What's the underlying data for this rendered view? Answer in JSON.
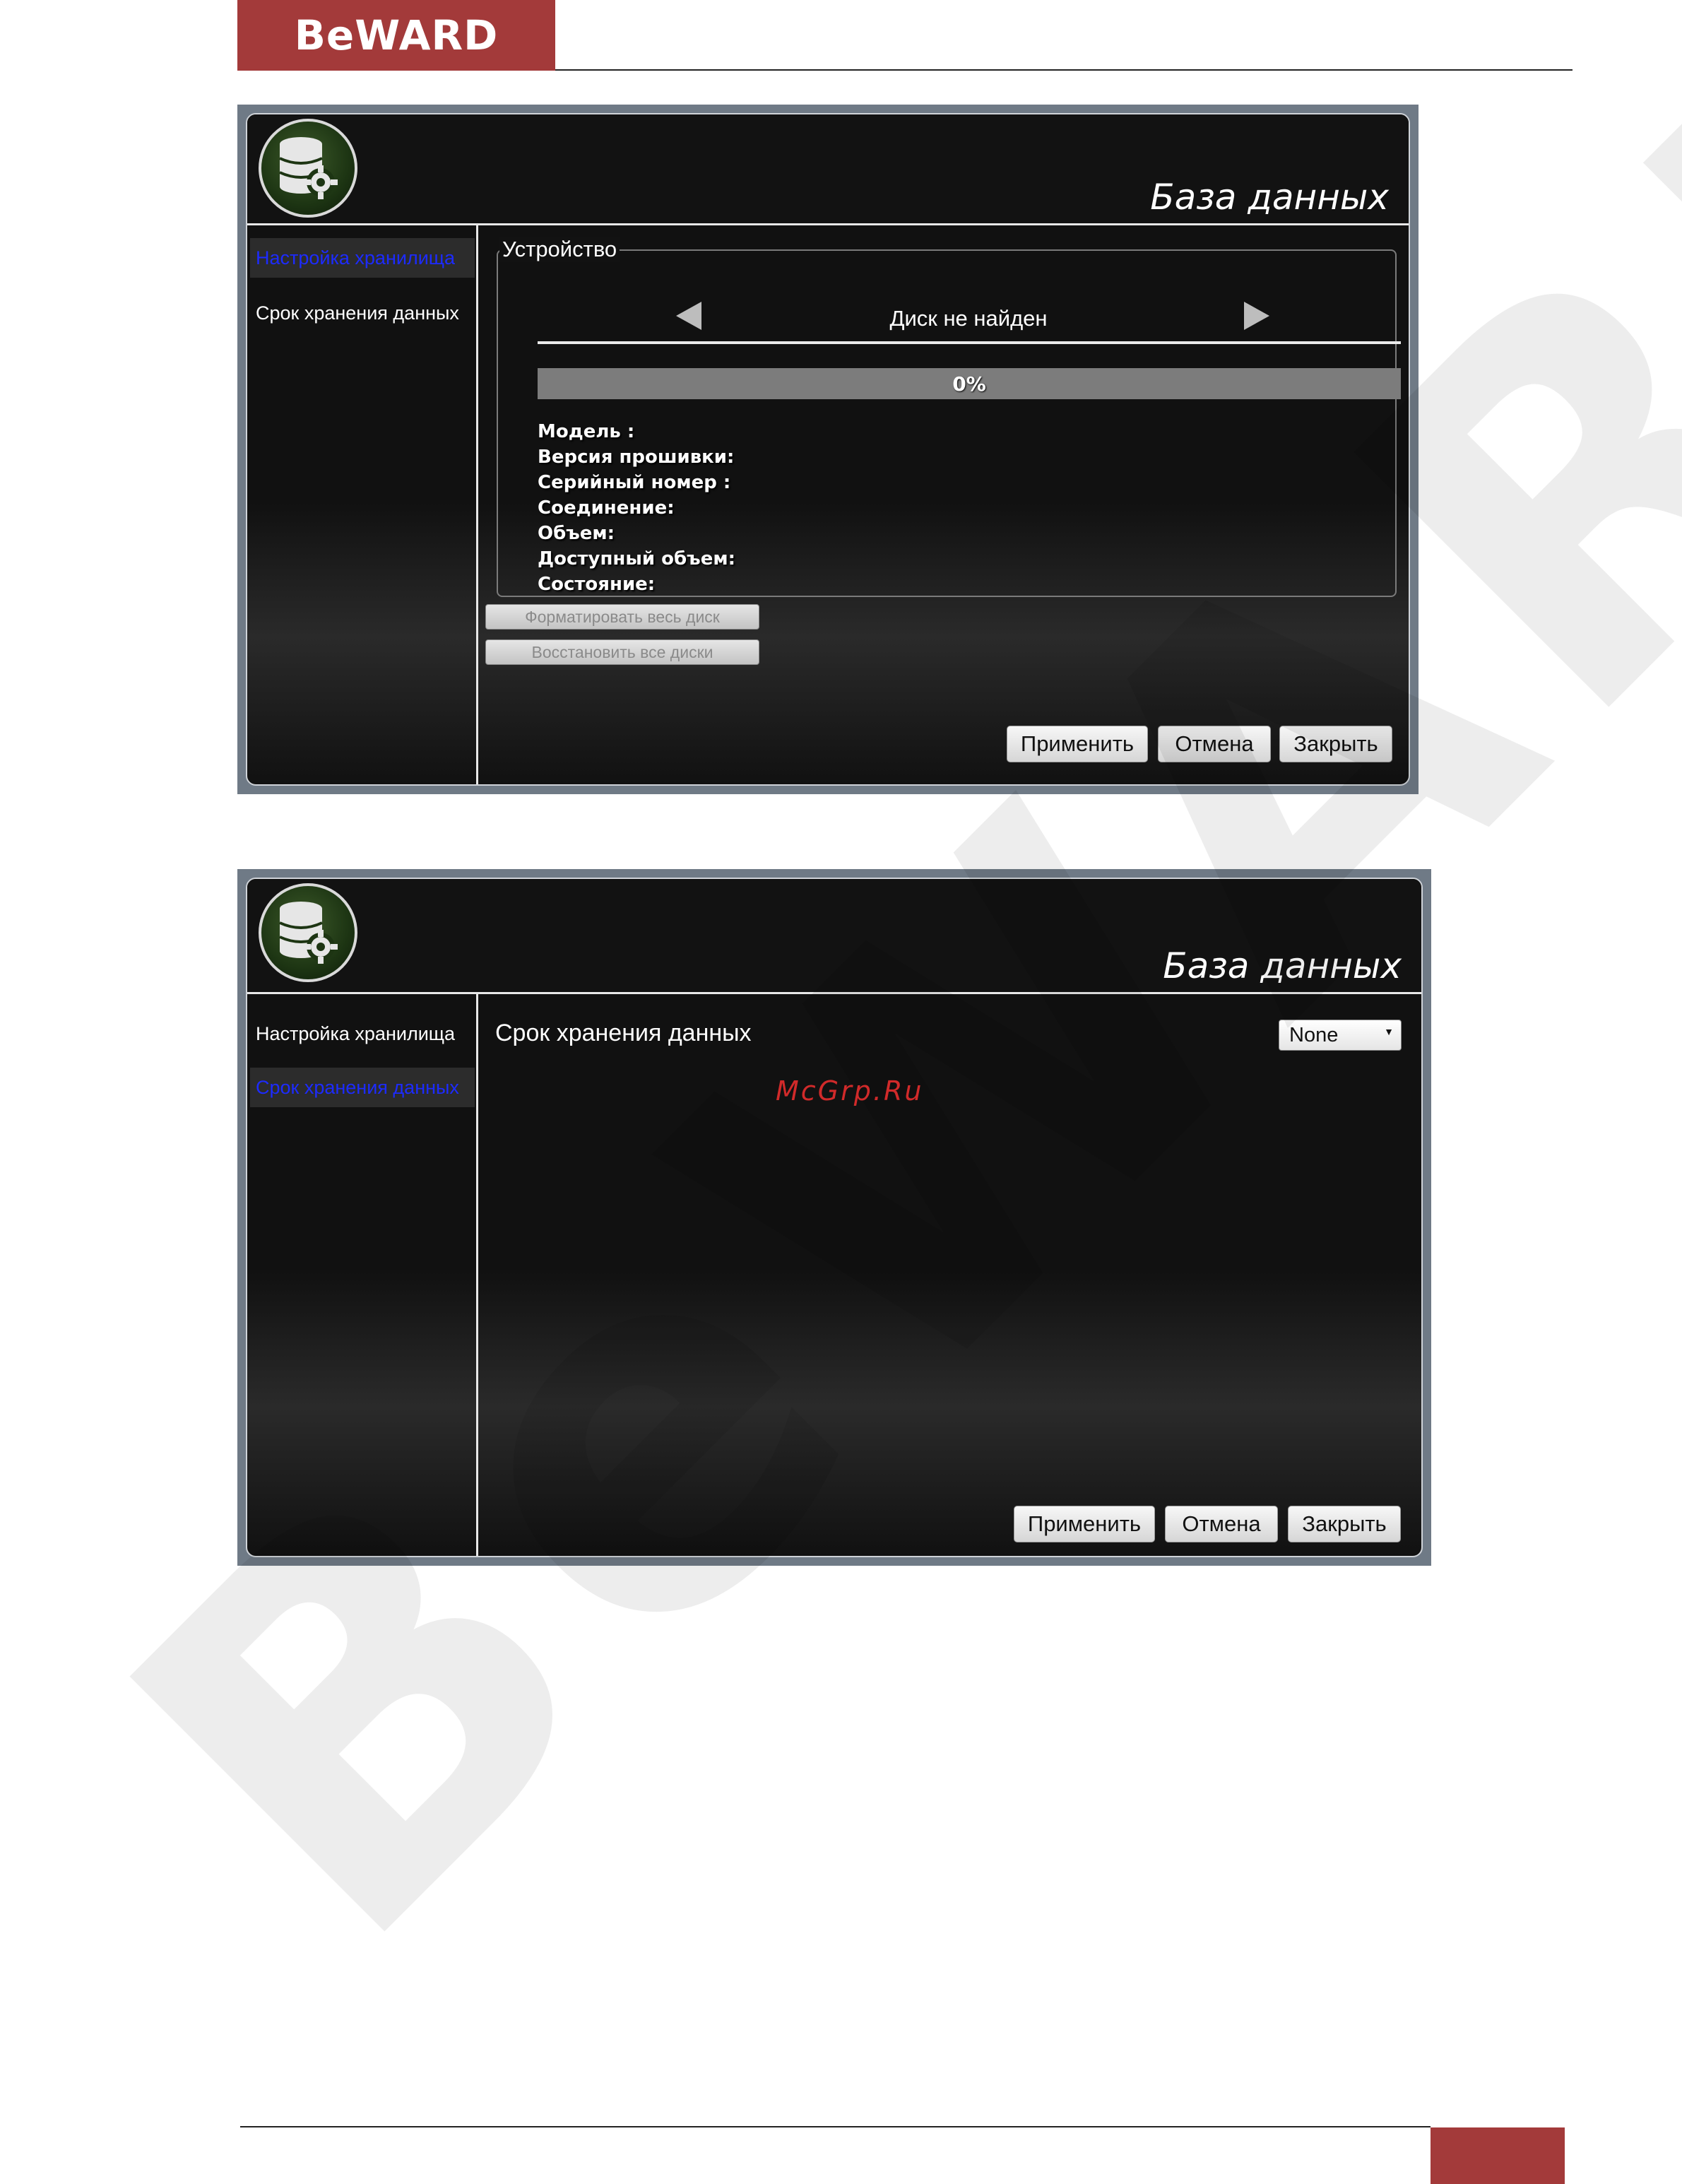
{
  "page": {
    "brand": "BeWARD",
    "watermark": "BeWARD",
    "site_mark": "McGrp.Ru"
  },
  "window1": {
    "title": "База данных",
    "sidebar": [
      {
        "label": "Настройка хранилища",
        "active": true
      },
      {
        "label": "Срок хранения данных",
        "active": false
      }
    ],
    "device": {
      "legend": "Устройство",
      "disk_label": "Диск не найден",
      "progress_percent": 0,
      "progress_text": "0%",
      "info": [
        "Модель :",
        "Версия прошивки:",
        "Серийный номер :",
        "Соединение:",
        "Объем:",
        "Доступный объем:",
        "Состояние:"
      ]
    },
    "format_button": "Форматировать весь диск",
    "restore_button": "Восстановить все диски",
    "apply": "Применить",
    "cancel": "Отмена",
    "close": "Закрыть"
  },
  "window2": {
    "title": "База данных",
    "sidebar": [
      {
        "label": "Настройка хранилища",
        "active": false
      },
      {
        "label": "Срок хранения данных",
        "active": true
      }
    ],
    "retention_label": "Срок хранения данных",
    "retention_value": "None",
    "apply": "Применить",
    "cancel": "Отмена",
    "close": "Закрыть"
  },
  "colors": {
    "brand": "#a33a3a",
    "active_link": "#1d2bff",
    "progress_fill": "#5fa64c",
    "frame": "#6f7a86"
  }
}
